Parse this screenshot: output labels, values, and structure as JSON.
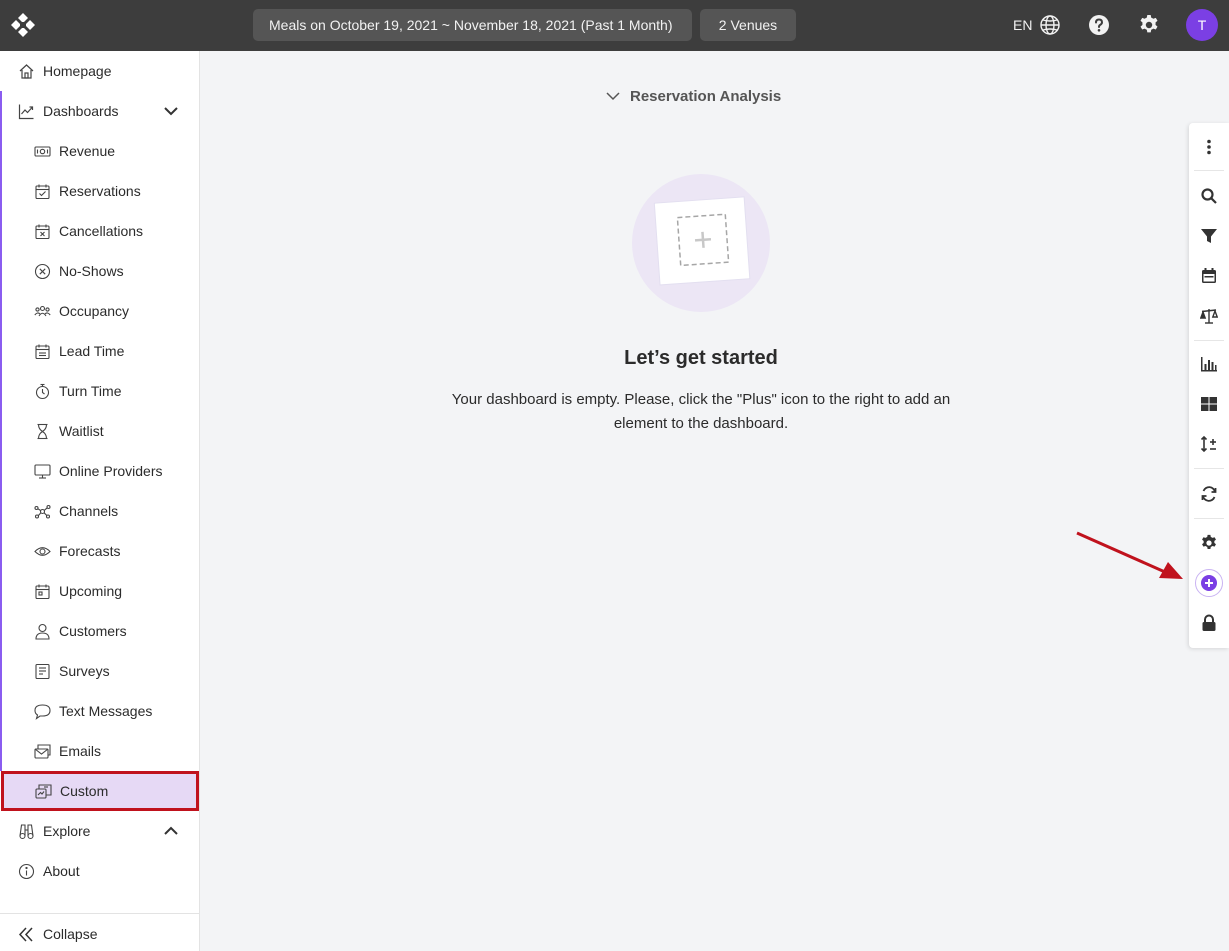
{
  "header": {
    "date_range": "Meals on October 19, 2021 ~ November 18, 2021 (Past 1 Month)",
    "venues": "2 Venues",
    "language": "EN",
    "avatar_initial": "T"
  },
  "sidebar": {
    "items": [
      {
        "label": "Homepage"
      },
      {
        "label": "Dashboards"
      },
      {
        "label": "Revenue"
      },
      {
        "label": "Reservations"
      },
      {
        "label": "Cancellations"
      },
      {
        "label": "No-Shows"
      },
      {
        "label": "Occupancy"
      },
      {
        "label": "Lead Time"
      },
      {
        "label": "Turn Time"
      },
      {
        "label": "Waitlist"
      },
      {
        "label": "Online Providers"
      },
      {
        "label": "Channels"
      },
      {
        "label": "Forecasts"
      },
      {
        "label": "Upcoming"
      },
      {
        "label": "Customers"
      },
      {
        "label": "Surveys"
      },
      {
        "label": "Text Messages"
      },
      {
        "label": "Emails"
      },
      {
        "label": "Custom"
      },
      {
        "label": "Explore"
      },
      {
        "label": "About"
      }
    ],
    "collapse_label": "Collapse"
  },
  "main": {
    "section_title": "Reservation Analysis",
    "empty_title": "Let’s get started",
    "empty_message": "Your dashboard is empty. Please, click the \"Plus\" icon to the right to add an element to the dashboard."
  },
  "colors": {
    "accent": "#7b3fe4",
    "active_bg": "#e6d9f5",
    "highlight": "#c0121d",
    "topbar": "#3d3d3d"
  }
}
